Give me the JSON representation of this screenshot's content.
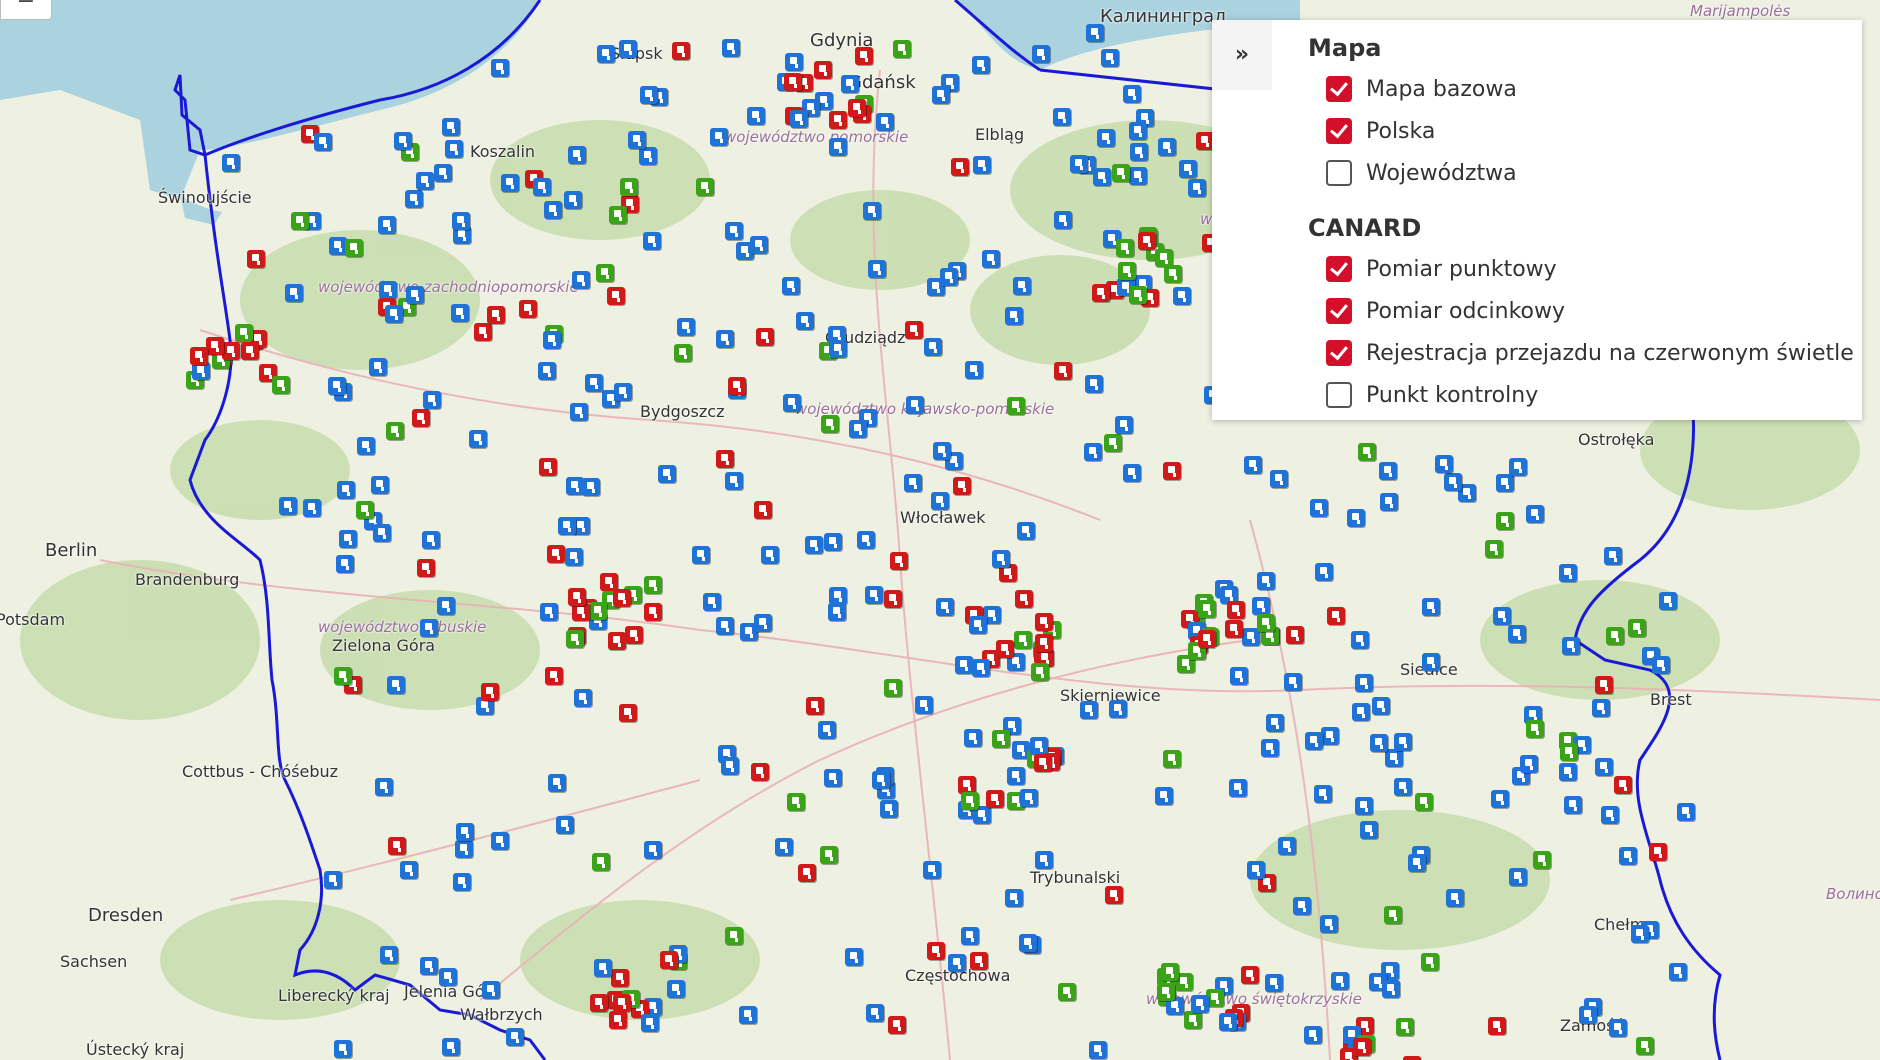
{
  "map": {
    "places": [
      {
        "name": "Gdynia"
      },
      {
        "name": "Gdańsk"
      },
      {
        "name": "Калининград"
      },
      {
        "name": "Elbląg"
      },
      {
        "name": "Koszalin"
      },
      {
        "name": "Świnoujście"
      },
      {
        "name": "Słupsk"
      },
      {
        "name": "Grudziądz"
      },
      {
        "name": "Bydgoszcz"
      },
      {
        "name": "Włocławek"
      },
      {
        "name": "Berlin"
      },
      {
        "name": "Brandenburg"
      },
      {
        "name": "Potsdam"
      },
      {
        "name": "Zielona Góra"
      },
      {
        "name": "Cottbus - Chóśebuz"
      },
      {
        "name": "Dresden"
      },
      {
        "name": "Sachsen"
      },
      {
        "name": "Liberecký kraj"
      },
      {
        "name": "Ústecký kraj"
      },
      {
        "name": "Jelenia Góra"
      },
      {
        "name": "Wałbrzych"
      },
      {
        "name": "Częstochowa"
      },
      {
        "name": "Trybunalski"
      },
      {
        "name": "Skierniewice"
      },
      {
        "name": "Siedlce"
      },
      {
        "name": "Chełm"
      },
      {
        "name": "Ostrołęka"
      },
      {
        "name": "Brest"
      },
      {
        "name": "Zamość"
      },
      {
        "name": "województwo zachodniopomorskie"
      },
      {
        "name": "województwo pomorskie"
      },
      {
        "name": "województwo warmińsko-mazurskie"
      },
      {
        "name": "województwo kujawsko-pomorskie"
      },
      {
        "name": "województwo lubuskie"
      },
      {
        "name": "województwo świętokrzyskie"
      },
      {
        "name": "Marijampolės"
      },
      {
        "name": "Волинська область"
      }
    ],
    "zoom_out_label": "−"
  },
  "legend": {
    "toggle_label": "»",
    "groups": [
      {
        "title": "Mapa",
        "items": [
          {
            "label": "Mapa bazowa",
            "checked": true
          },
          {
            "label": "Polska",
            "checked": true
          },
          {
            "label": "Województwa",
            "checked": false
          }
        ]
      },
      {
        "title": "CANARD",
        "items": [
          {
            "label": "Pomiar punktowy",
            "checked": true
          },
          {
            "label": "Pomiar odcinkowy",
            "checked": true
          },
          {
            "label": "Rejestracja przejazdu na czerwonym świetle",
            "checked": true
          },
          {
            "label": "Punkt kontrolny",
            "checked": false
          }
        ]
      }
    ]
  },
  "colors": {
    "pomiar_punktowy": "#1f72d6",
    "pomiar_odcinkowy": "#3aa317",
    "czerwone_swiatlo": "#d01919",
    "border": "#1a1ad6",
    "sea": "#aad3df",
    "land": "#eef0e2",
    "forest": "#c9deb0"
  }
}
